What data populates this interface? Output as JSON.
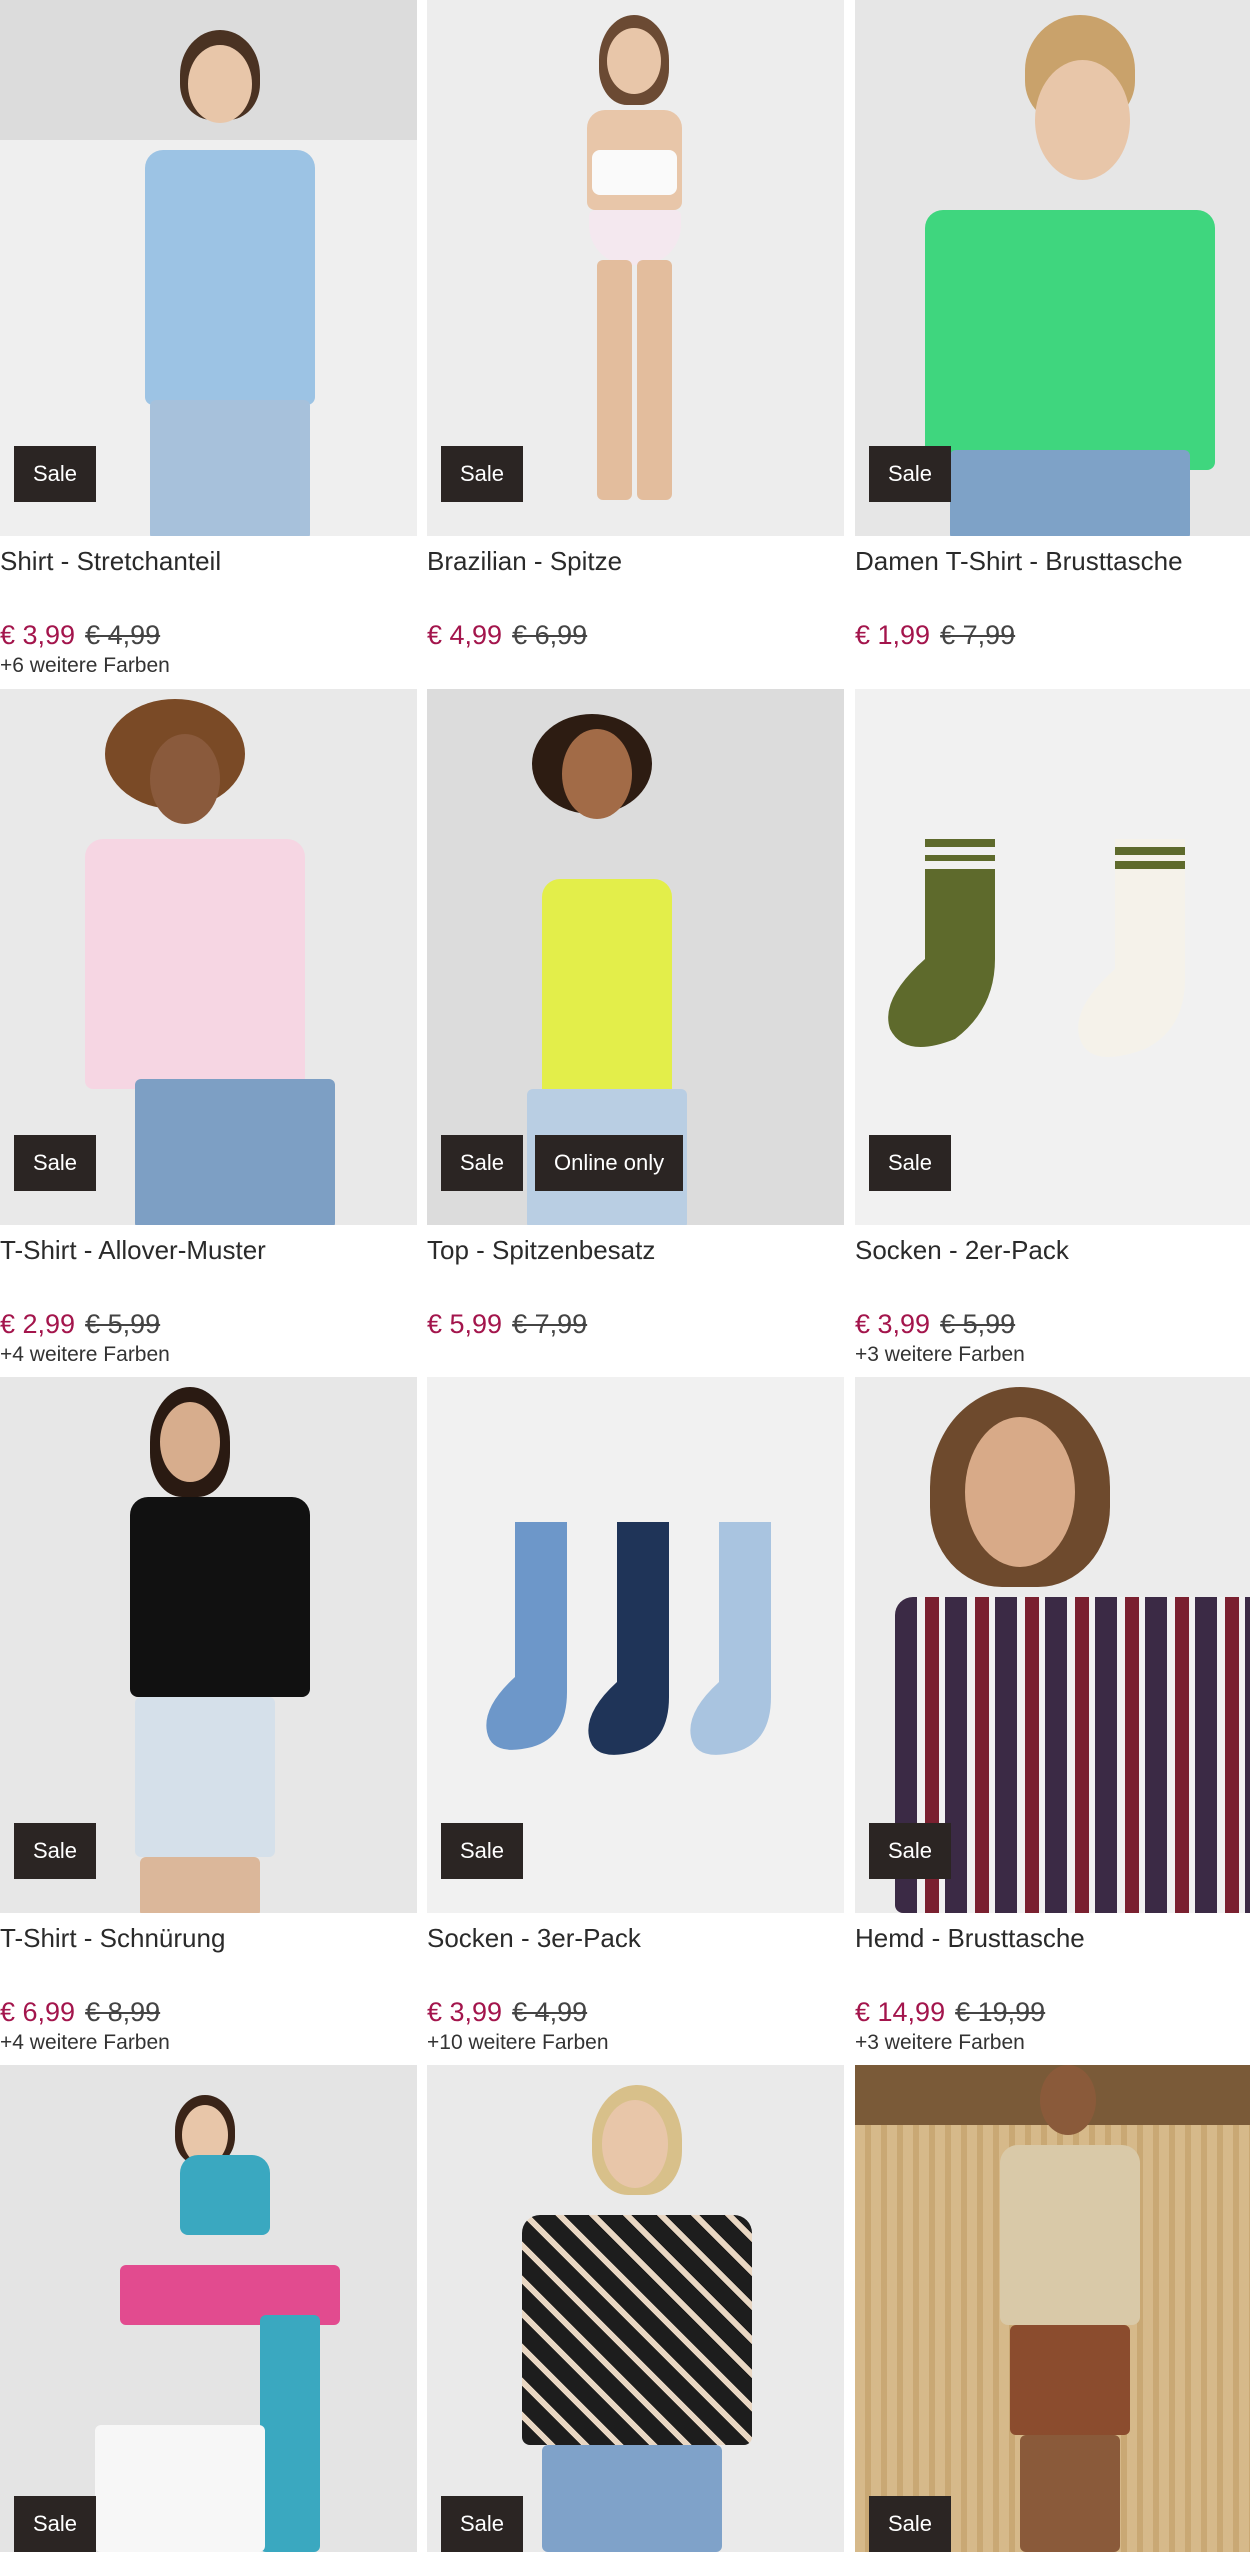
{
  "products": [
    {
      "title": "Shirt - Stretchanteil",
      "price": "€ 3,99",
      "old_price": "€ 4,99",
      "more_colors": "+6 weitere Farben",
      "badges": [
        "Sale"
      ],
      "accent": "#9cc3e4"
    },
    {
      "title": "Brazilian - Spitze",
      "price": "€ 4,99",
      "old_price": "€ 6,99",
      "more_colors": "",
      "badges": [
        "Sale"
      ],
      "accent": "#f4f4f4"
    },
    {
      "title": "Damen T-Shirt - Brusttasche",
      "price": "€ 1,99",
      "old_price": "€ 7,99",
      "more_colors": "",
      "badges": [
        "Sale"
      ],
      "accent": "#3fd67e"
    },
    {
      "title": "T-Shirt - Allover-Muster",
      "price": "€ 2,99",
      "old_price": "€ 5,99",
      "more_colors": "+4 weitere Farben",
      "badges": [
        "Sale"
      ],
      "accent": "#f6d6e3"
    },
    {
      "title": "Top - Spitzenbesatz",
      "price": "€ 5,99",
      "old_price": "€ 7,99",
      "more_colors": "",
      "badges": [
        "Sale",
        "Online only"
      ],
      "accent": "#e3ee4a"
    },
    {
      "title": "Socken - 2er-Pack",
      "price": "€ 3,99",
      "old_price": "€ 5,99",
      "more_colors": "+3 weitere Farben",
      "badges": [
        "Sale"
      ],
      "accent": "#5e6a2c"
    },
    {
      "title": "T-Shirt - Schnürung",
      "price": "€ 6,99",
      "old_price": "€ 8,99",
      "more_colors": "+4 weitere Farben",
      "badges": [
        "Sale"
      ],
      "accent": "#111111"
    },
    {
      "title": "Socken - 3er-Pack",
      "price": "€ 3,99",
      "old_price": "€ 4,99",
      "more_colors": "+10 weitere Farben",
      "badges": [
        "Sale"
      ],
      "accent": "#6d97c9"
    },
    {
      "title": "Hemd - Brusttasche",
      "price": "€ 14,99",
      "old_price": "€ 19,99",
      "more_colors": "+3 weitere Farben",
      "badges": [
        "Sale"
      ],
      "accent": "#3b2a45"
    },
    {
      "title": "",
      "price": "",
      "old_price": "",
      "more_colors": "",
      "badges": [
        "Sale"
      ],
      "accent": "#3aa8c0"
    },
    {
      "title": "",
      "price": "",
      "old_price": "",
      "more_colors": "",
      "badges": [
        "Sale"
      ],
      "accent": "#1d1d1d"
    },
    {
      "title": "",
      "price": "",
      "old_price": "",
      "more_colors": "",
      "badges": [
        "Sale"
      ],
      "accent": "#d9c9a8"
    }
  ]
}
